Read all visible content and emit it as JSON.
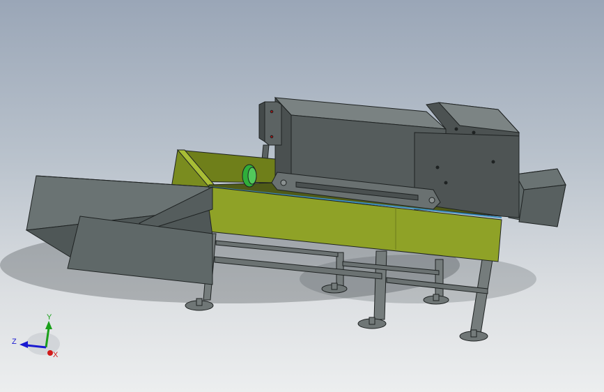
{
  "viewport": {
    "background_top": "#9aa6b7",
    "background_bottom": "#eceeef"
  },
  "model": {
    "colors": {
      "frame_green": "#8fa227",
      "frame_green_dark": "#6f7f1a",
      "hopper_gray": "#5f6868",
      "housing_gray": "#555c5c",
      "housing_top": "#7a8282",
      "leg_gray": "#757c7c",
      "edge": "#1e2222"
    }
  },
  "triad": {
    "x_label": "X",
    "y_label": "Y",
    "z_label": "Z",
    "x_color": "#d11a1a",
    "y_color": "#1aa01a",
    "z_color": "#1a1ad1"
  }
}
